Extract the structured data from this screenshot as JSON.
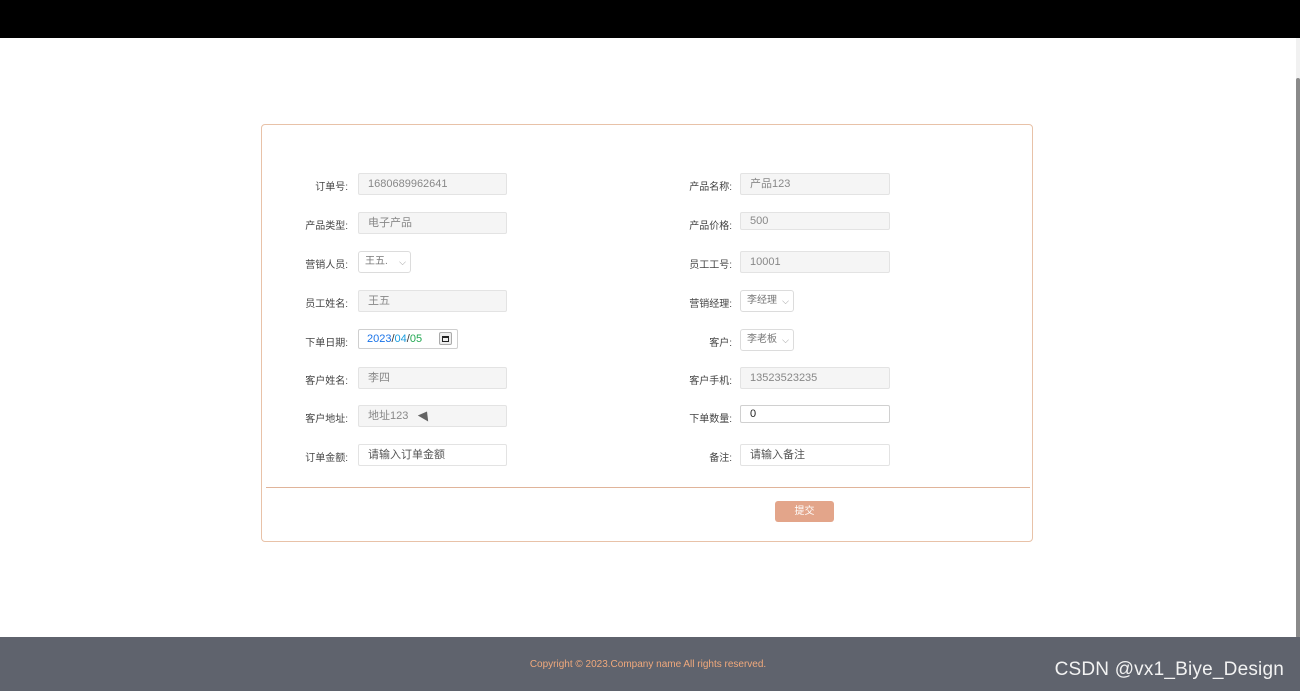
{
  "form": {
    "left": [
      {
        "label": "订单号:",
        "value": "1680689962641",
        "kind": "readonly"
      },
      {
        "label": "产品类型:",
        "value": "电子产品",
        "kind": "readonly"
      },
      {
        "label": "营销人员:",
        "value": "王五.",
        "kind": "select"
      },
      {
        "label": "员工姓名:",
        "value": "王五",
        "kind": "readonly"
      },
      {
        "label": "下单日期:",
        "date": {
          "year": "2023",
          "month": "04",
          "day": "05",
          "sep": "/"
        },
        "kind": "date"
      },
      {
        "label": "客户姓名:",
        "value": "李四",
        "kind": "readonly"
      },
      {
        "label": "客户地址:",
        "value": "地址123",
        "kind": "readonly"
      },
      {
        "label": "订单金额:",
        "value": "请输入订单金额",
        "kind": "input"
      }
    ],
    "right": [
      {
        "label": "产品名称:",
        "value": "产品123",
        "kind": "readonly"
      },
      {
        "label": "产品价格:",
        "value": "500",
        "kind": "readonly"
      },
      {
        "label": "员工工号:",
        "value": "10001",
        "kind": "readonly"
      },
      {
        "label": "营销经理:",
        "value": "李经理",
        "kind": "select"
      },
      {
        "label": "客户:",
        "value": "李老板",
        "kind": "select"
      },
      {
        "label": "客户手机:",
        "value": "13523523235",
        "kind": "readonly"
      },
      {
        "label": "下单数量:",
        "value": "0",
        "kind": "editable"
      },
      {
        "label": "备注:",
        "value": "请输入备注",
        "kind": "input"
      }
    ],
    "submit_label": "提交"
  },
  "footer": {
    "copyright": "Copyright © 2023.Company name All rights reserved.",
    "watermark": "CSDN @vx1_Biye_Design"
  },
  "colors": {
    "accent": "#e3a58a",
    "card_border": "#e8c2a8",
    "footer_bg": "#5f636d",
    "footer_text": "#f0a97c"
  }
}
